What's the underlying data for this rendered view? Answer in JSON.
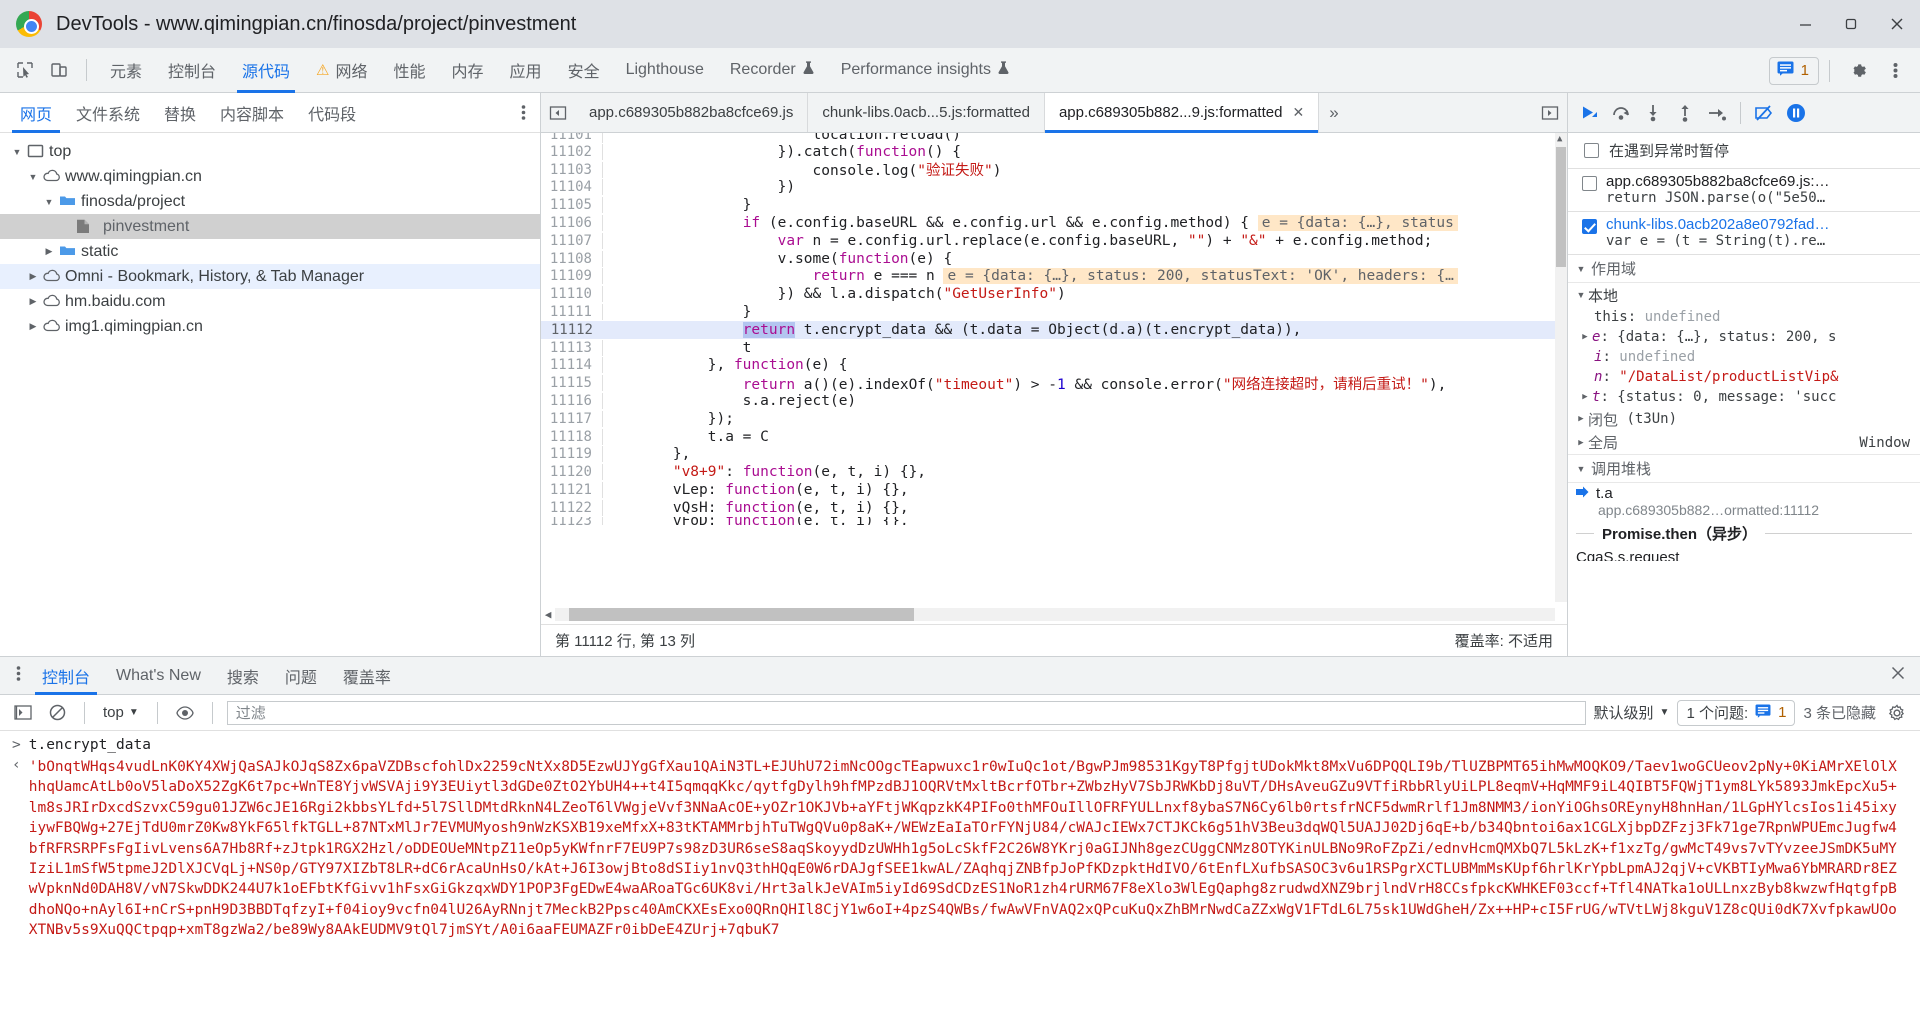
{
  "window": {
    "title": "DevTools - www.qimingpian.cn/finosda/project/pinvestment",
    "minimize_label": "Minimize",
    "maximize_label": "Maximize",
    "close_label": "Close"
  },
  "main_tabs": {
    "items": [
      {
        "label": "元素",
        "selected": false,
        "warn": false
      },
      {
        "label": "控制台",
        "selected": false,
        "warn": false
      },
      {
        "label": "源代码",
        "selected": true,
        "warn": false
      },
      {
        "label": "网络",
        "selected": false,
        "warn": true
      },
      {
        "label": "性能",
        "selected": false,
        "warn": false
      },
      {
        "label": "内存",
        "selected": false,
        "warn": false
      },
      {
        "label": "应用",
        "selected": false,
        "warn": false
      },
      {
        "label": "安全",
        "selected": false,
        "warn": false
      },
      {
        "label": "Lighthouse",
        "selected": false,
        "warn": false
      },
      {
        "label": "Recorder",
        "selected": false,
        "warn": false,
        "flask": true
      },
      {
        "label": "Performance insights",
        "selected": false,
        "warn": false,
        "flask": true
      }
    ],
    "message_count": "1",
    "settings_label": "设置",
    "more_label": "自定义及控制 DevTools"
  },
  "navigator": {
    "tabs": [
      {
        "label": "网页",
        "selected": true
      },
      {
        "label": "文件系统",
        "selected": false
      },
      {
        "label": "替换",
        "selected": false
      },
      {
        "label": "内容脚本",
        "selected": false
      },
      {
        "label": "代码段",
        "selected": false
      }
    ],
    "more_label": "更多选项",
    "tree": [
      {
        "label": "top",
        "icon": "frame-icon",
        "depth": 0,
        "expanded": true,
        "state": "none"
      },
      {
        "label": "www.qimingpian.cn",
        "icon": "cloud-icon",
        "depth": 1,
        "expanded": true,
        "state": "none"
      },
      {
        "label": "finosda/project",
        "icon": "folder-icon",
        "depth": 2,
        "expanded": true,
        "state": "none"
      },
      {
        "label": "pinvestment",
        "icon": "file-icon",
        "depth": 3,
        "expanded": null,
        "state": "selected-grey"
      },
      {
        "label": "static",
        "icon": "folder-icon",
        "depth": 2,
        "expanded": false,
        "state": "none"
      },
      {
        "label": "Omni - Bookmark, History, & Tab Manager",
        "icon": "cloud-icon",
        "depth": 1,
        "expanded": false,
        "state": "selected-blue"
      },
      {
        "label": "hm.baidu.com",
        "icon": "cloud-icon",
        "depth": 1,
        "expanded": false,
        "state": "none"
      },
      {
        "label": "img1.qimingpian.cn",
        "icon": "cloud-icon",
        "depth": 1,
        "expanded": false,
        "state": "none"
      }
    ]
  },
  "source_tabs": {
    "back_label": "显示导航器",
    "items": [
      {
        "label": "app.c689305b882ba8cfce69.js",
        "selected": false,
        "closable": false
      },
      {
        "label": "chunk-libs.0acb...5.js:formatted",
        "selected": false,
        "closable": false
      },
      {
        "label": "app.c689305b882...9.js:formatted",
        "selected": true,
        "closable": true
      }
    ],
    "overflow_label": "更多标签页",
    "forward_label": "显示调试程序"
  },
  "editor": {
    "lines": [
      {
        "n": "11101",
        "text": "                        location.reload()",
        "clipped": true
      },
      {
        "n": "11102",
        "text": "                    }).catch(function() {"
      },
      {
        "n": "11103",
        "text": "                        console.log(\"验证失败\")"
      },
      {
        "n": "11104",
        "text": "                    })"
      },
      {
        "n": "11105",
        "text": "                }"
      },
      {
        "n": "11106",
        "text": "                if (e.config.baseURL && e.config.url && e.config.method) {",
        "hint": "e = {data: {…}, status"
      },
      {
        "n": "11107",
        "text": "                    var n = e.config.url.replace(e.config.baseURL, \"\") + \"&\" + e.config.method;"
      },
      {
        "n": "11108",
        "text": "                    v.some(function(e) {"
      },
      {
        "n": "11109",
        "text": "                        return e === n",
        "hint": "e = {data: {…}, status: 200, statusText: 'OK', headers: {…"
      },
      {
        "n": "11110",
        "text": "                    }) && l.a.dispatch(\"GetUserInfo\")"
      },
      {
        "n": "11111",
        "text": "                }"
      },
      {
        "n": "11112",
        "text": "                return t.encrypt_data && (t.data = Object(d.a)(t.encrypt_data)),",
        "highlight": true
      },
      {
        "n": "11113",
        "text": "                t"
      },
      {
        "n": "11114",
        "text": "            }, function(e) {"
      },
      {
        "n": "11115",
        "text": "                return a()(e).indexOf(\"timeout\") > -1 && console.error(\"网络连接超时，请稍后重试！\"),"
      },
      {
        "n": "11116",
        "text": "                s.a.reject(e)"
      },
      {
        "n": "11117",
        "text": "            });"
      },
      {
        "n": "11118",
        "text": "            t.a = C"
      },
      {
        "n": "11119",
        "text": "        },"
      },
      {
        "n": "11120",
        "text": "        \"v8+9\": function(e, t, i) {},"
      },
      {
        "n": "11121",
        "text": "        vLep: function(e, t, i) {},"
      },
      {
        "n": "11122",
        "text": "        vQsH: function(e, t, i) {},"
      },
      {
        "n": "11123",
        "text": "        vFoD: function(e, t, i) {},",
        "clipped": true
      }
    ],
    "status_position": "第 11112 行, 第 13 列",
    "status_coverage": "覆盖率: 不适用"
  },
  "debugger": {
    "toolbar": [
      {
        "name": "resume-button",
        "label": "继续执行脚本"
      },
      {
        "name": "step-over-button",
        "label": "跳过下一个函数调用"
      },
      {
        "name": "step-into-button",
        "label": "单步调试下一个函数调用"
      },
      {
        "name": "step-out-button",
        "label": "跳出当前函数"
      },
      {
        "name": "step-button",
        "label": "步进"
      },
      {
        "name": "deactivate-breakpoints-button",
        "label": "停用断点"
      },
      {
        "name": "pause-on-exceptions-button",
        "label": "在出现异常时暂停"
      }
    ],
    "pause_on_exceptions": {
      "label": "在遇到异常时暂停",
      "checked": false
    },
    "breakpoints": [
      {
        "file": "app.c689305b882ba8cfce69.js:…",
        "code": "return JSON.parse(o(\"5e50…",
        "checked": false
      },
      {
        "file": "chunk-libs.0acb202a8e0792fad…",
        "code": "var e = (t = String(t).re…",
        "checked": true
      }
    ],
    "scope_section": "作用域",
    "scope_local": "本地",
    "scope_vars": [
      {
        "name": "this",
        "value": "undefined",
        "kind": "undef",
        "expandable": false,
        "italic": false
      },
      {
        "name": "e",
        "value": "{data: {…}, status: 200, s",
        "kind": "obj",
        "expandable": true,
        "italic": true
      },
      {
        "name": "i",
        "value": "undefined",
        "kind": "undef",
        "expandable": false,
        "italic": true
      },
      {
        "name": "n",
        "value": "\"/DataList/productListVip&",
        "kind": "str",
        "expandable": false,
        "italic": true
      },
      {
        "name": "t",
        "value": "{status: 0, message: 'succ",
        "kind": "obj",
        "expandable": true,
        "italic": true
      }
    ],
    "scope_closure": {
      "label": "闭包",
      "detail": "(t3Un)"
    },
    "scope_global": {
      "label": "全局",
      "value": "Window"
    },
    "callstack_section": "调用堆栈",
    "callstack": [
      {
        "fn": "t.a",
        "loc": "app.c689305b882…ormatted:11112",
        "active": true
      }
    ],
    "async_label": "Promise.then（异步）",
    "async_next": "CgaS.s.request"
  },
  "drawer": {
    "more_label": "更多工具",
    "tabs": [
      {
        "label": "控制台",
        "selected": true
      },
      {
        "label": "What's New",
        "selected": false
      },
      {
        "label": "搜索",
        "selected": false
      },
      {
        "label": "问题",
        "selected": false
      },
      {
        "label": "覆盖率",
        "selected": false
      }
    ],
    "close_label": "关闭",
    "toolbar": {
      "sidebar_label": "显示控制台边栏",
      "clear_label": "清空控制台",
      "context": "top",
      "eye_label": "创建实时表达式",
      "filter_placeholder": "过滤",
      "level": "默认级别",
      "issues": "1 个问题:",
      "issues_count": "1",
      "hidden": "3 条已隐藏",
      "settings_label": "控制台设置"
    },
    "command": "t.encrypt_data",
    "result": "'bOnqtWHqs4vudLnK0KY4XWjQaSAJkOJqS8Zx6paVZDBscfohlDx2259cNtXx8D5EzwUJYgGfXau1QAiN3TL+EJUhU72imNcOOgcTEapwuxc1r0wIuQc1ot/BgwPJm98531KgyT8PfgjtUDokMkt8MxVu6DPQQLI9b/TlUZBPMT65ihMwMOQKO9/Taev1woGCUeov2pNy+0KiAMrXElOlXhhqUamcAtLb0oV5laDoX52ZgK6t7pc+WnTE8YjvWSVAji9Y3EUiytl3dGDe0ZtO2YbUH4++t4I5qmqqKkc/qytfgDylh9hfMPzdBJ1OQRVtMxltBcrfOTbr+ZWbzHyV7SbJRWKbDj8uVT/DHsAveuGZu9VTfiRbbRlyUiLPL8eqmV+HqMMF9iL4QIBT5FQWjT1ym8LYk5893JmkEpcXu5+lm8sJRIrDxcdSzvxC59gu01JZW6cJE16Rgi2kbbsYLfd+5l7SllDMtdRknN4LZeoT6lVWgjeVvf3NNaAcOE+yOZr1OKJVb+aYFtjWKqpzkK4PIFo0thMFOuIllOFRFYULLnxf8ybaS7N6Cy6lb0rtsfrNCF5dwmRrlf1Jm8NMM3/ionYiOGhsOREynyH8hnHan/1LGpHYlcsIos1i45ixyiywFBQWg+27EjTdU0mrZ0Kw8YkF65lfkTGLL+87NTxMlJr7EVMUMyosh9nWzKSXB19xeMfxX+83tKTAMMrbjhTuTWgQVu0p8aK+/WEWzEaIaTOrFYNjU84/cWAJcIEWx7CTJKCk6g51hV3Beu3dqWQl5UAJJ02Dj6qE+b/b34Qbntoi6ax1CGLXjbpDZFzj3Fk71ge7RpnWPUEmcJugfw4bfRFRSRPFsFgIivLvens6A7Hb8Rf+zJtpk1RGX2Hzl/oDDEOUeMNtpZ11eOp5yKWfnrF7EU9P7s98zD3UR6seS8aqSkoyydDzUWHh1g5oLcSkfF2C26W8YKrj0aGIJNh8gezCUggCNMz8OTYKinULBNo9RoFZpZi/ednvHcmQMXbQ7L5kLzK+f1xzTg/gwMcT49vs7vTYvzeeJSmDK5uMYIziL1mSfW5tpmeJ2DlXJCVqLj+NS0p/GTY97XIZbT8LR+dC6rAcaUnHsO/kAt+J6I3owjBto8dSIiy1nvQ3thHQqE0W6rDAJgfSEE1kwAL/ZAqhqjZNBfpJoPfKDzpktHdIVO/6tEnfLXufbSASOC3v6u1RSPgrXCTLUBMmMsKUpf6hrlKrYpbLpmAJ2qjV+cVKBTIyMwa6YbMRARDr8EZwVpknNd0DAH8V/vN7SkwDDK244U7k1oEFbtKfGivv1hFsxGiGkzqxWDY1POP3FgEDwE4waARoaTGc6UK8vi/Hrt3alkJeVAIm5iyId69SdCDzES1NoR1zh4rURM67F8eXlo3WlEgQaphg8zrudwdXNZ9brjlndVrH8CCsfpkcKWHKEF03ccf+Tfl4NATka1oULLnxzByb8kwzwfHqtgfpBdhoNQo+nAyl6I+nCrS+pnH9D3BBDTqfzyI+f04ioy9vcfn04lU26AyRNnjt7MeckB2Ppsc40AmCKXEsExo0QRnQHIl8CjY1w6oI+4pzS4QWBs/fwAwVFnVAQ2xQPcuKuQxZhBMrNwdCaZZxWgV1FTdL6L75sk1UWdGheH/Zx++HP+cI5FrUG/wTVtLWj8kguV1Z8cQUi0dK7XvfpkawUOoXTNBv5s9XuQQCtpqp+xmT8gzWa2/be89Wy8AAkEUDMV9tQl7jmSYt/A0i6aaFEUMAZFr0ibDeE4ZUrj+7qbuK7"
  }
}
